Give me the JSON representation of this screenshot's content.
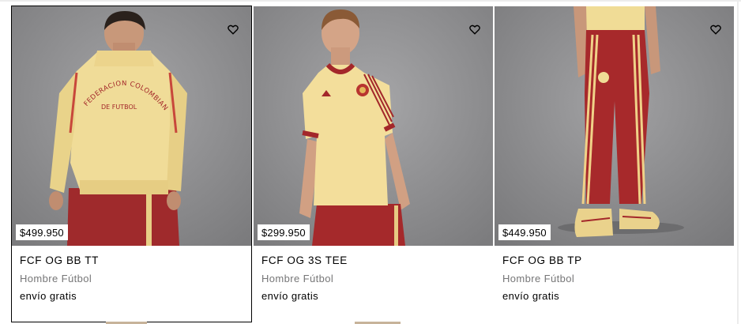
{
  "products": [
    {
      "name": "FCF OG BB TT",
      "category": "Hombre Fútbol",
      "price": "$499.950",
      "shipping": "envío gratis",
      "wishlist_icon": "heart-icon",
      "hovered": true,
      "jacket_text_1": "FEDERACION COLOMBIANA",
      "jacket_text_2": "DE FUTBOL"
    },
    {
      "name": "FCF OG 3S TEE",
      "category": "Hombre Fútbol",
      "price": "$299.950",
      "shipping": "envío gratis",
      "wishlist_icon": "heart-icon",
      "hovered": false
    },
    {
      "name": "FCF OG BB TP",
      "category": "Hombre Fútbol",
      "price": "$449.950",
      "shipping": "envío gratis",
      "wishlist_icon": "heart-icon",
      "hovered": false
    }
  ],
  "colors": {
    "background_gray": "#8d8d8f",
    "cream": "#f2dc92",
    "red": "#a3272a",
    "muted_text": "#767677"
  }
}
